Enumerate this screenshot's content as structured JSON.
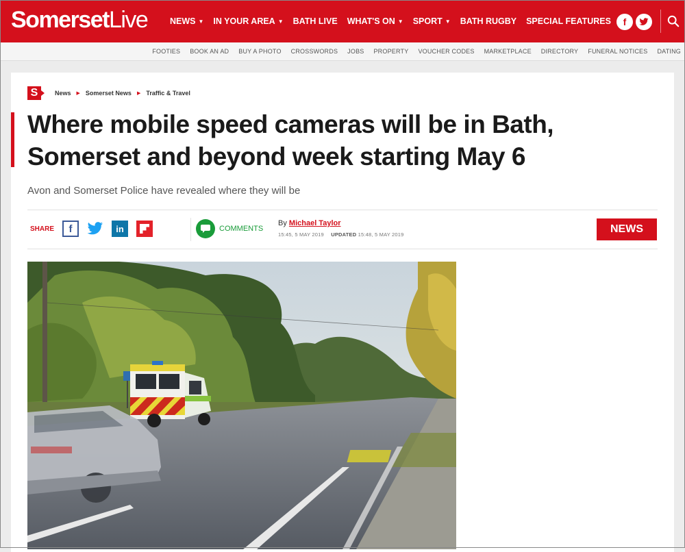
{
  "brand": {
    "logo_part1": "Somerset",
    "logo_part2": "Live",
    "color": "#d4101c"
  },
  "nav": {
    "items": [
      {
        "label": "NEWS",
        "dropdown": true
      },
      {
        "label": "IN YOUR AREA",
        "dropdown": true
      },
      {
        "label": "BATH LIVE",
        "dropdown": false
      },
      {
        "label": "WHAT'S ON",
        "dropdown": true
      },
      {
        "label": "SPORT",
        "dropdown": true
      },
      {
        "label": "BATH RUGBY",
        "dropdown": false
      },
      {
        "label": "SPECIAL FEATURES",
        "dropdown": false
      }
    ],
    "social": [
      {
        "icon": "facebook-icon",
        "glyph": "f"
      },
      {
        "icon": "twitter-icon",
        "glyph": "t"
      }
    ],
    "search_icon": "search-icon"
  },
  "subnav": {
    "items": [
      "FOOTIES",
      "BOOK AN AD",
      "BUY A PHOTO",
      "CROSSWORDS",
      "JOBS",
      "PROPERTY",
      "VOUCHER CODES",
      "MARKETPLACE",
      "DIRECTORY",
      "FUNERAL NOTICES",
      "DATING"
    ]
  },
  "article": {
    "badge": "S",
    "breadcrumbs": [
      "News",
      "Somerset News",
      "Traffic & Travel"
    ],
    "headline": "Where mobile speed cameras will be in Bath, Somerset and beyond week starting May 6",
    "standfirst": "Avon and Somerset Police have revealed where they will be",
    "share_label": "SHARE",
    "comments_label": "COMMENTS",
    "by_prefix": "By",
    "author": "Michael Taylor",
    "published": "15:45, 5 MAY 2019",
    "updated_label": "UPDATED",
    "updated": "15:48, 5 MAY 2019",
    "category_badge": "NEWS"
  }
}
